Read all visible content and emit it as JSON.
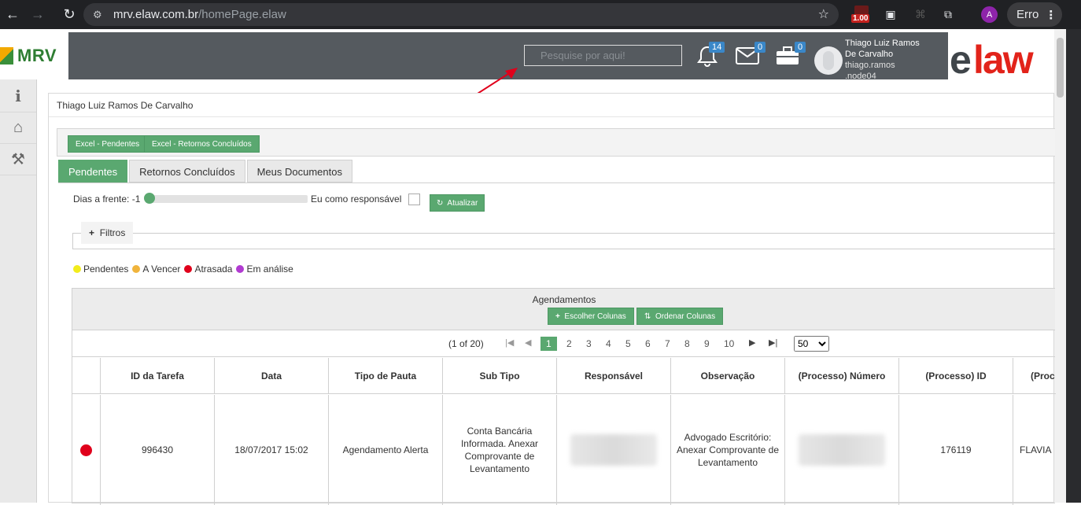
{
  "browser": {
    "url_host": "mrv.elaw.com.br",
    "url_path": "/homePage.elaw",
    "ext_badge": "1.00",
    "profile_initial": "A",
    "error_label": "Erro"
  },
  "header": {
    "brand": "MRV",
    "search_placeholder": "Pesquise por aqui!",
    "notifications_count": "14",
    "messages_count": "0",
    "briefcase_count": "0",
    "user_name_1": "Thiago Luiz Ramos",
    "user_name_2": "De Carvalho",
    "user_login": "thiago.ramos",
    "user_node": ".node04",
    "logo_e": "e",
    "logo_law": "law"
  },
  "panel": {
    "title": "Thiago Luiz Ramos De Carvalho",
    "excel_pendentes": "Excel - Pendentes",
    "excel_retornos": "Excel - Retornos Concluídos",
    "tabs": [
      "Pendentes",
      "Retornos Concluídos",
      "Meus Documentos"
    ],
    "dias_label": "Dias a frente: -1",
    "eu_como": "Eu como responsável",
    "atualizar": "Atualizar",
    "filtros": "Filtros",
    "status": [
      {
        "label": "Pendentes",
        "color": "#f2ec1c"
      },
      {
        "label": "A Vencer",
        "color": "#f0b43c"
      },
      {
        "label": "Atrasada",
        "color": "#e0001b"
      },
      {
        "label": "Em análise",
        "color": "#b13bd1"
      }
    ]
  },
  "grid": {
    "title": "Agendamentos",
    "escolher_colunas": "Escolher Colunas",
    "ordenar_colunas": "Ordenar Colunas",
    "page_info": "(1 of 20)",
    "pages": [
      "1",
      "2",
      "3",
      "4",
      "5",
      "6",
      "7",
      "8",
      "9",
      "10"
    ],
    "per_page": "50",
    "columns": [
      "ID da Tarefa",
      "Data",
      "Tipo de Pauta",
      "Sub Tipo",
      "Responsável",
      "Observação",
      "(Processo) Número",
      "(Processo) ID",
      "(Proc Co"
    ],
    "rows": [
      {
        "id": "996430",
        "data": "18/07/2017 15:02",
        "tipo": "Agendamento Alerta",
        "subtipo": "Conta Bancária Informada. Anexar Comprovante de Levantamento",
        "observacao": "Advogado Escritório: Anexar Comprovante de Levantamento",
        "processo_id": "176119",
        "processo_co": "FLAVIA"
      }
    ]
  }
}
